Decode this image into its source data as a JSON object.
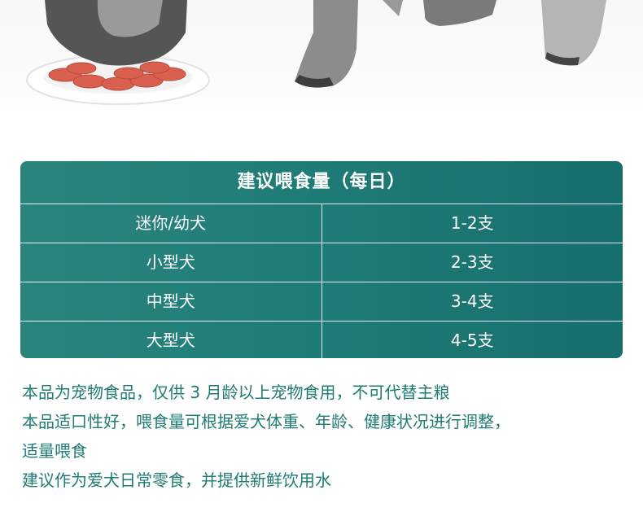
{
  "feeding_table": {
    "title": "建议喂食量（每日）",
    "rows": [
      {
        "size": "迷你/幼犬",
        "amount": "1-2支"
      },
      {
        "size": "小型犬",
        "amount": "2-3支"
      },
      {
        "size": "中型犬",
        "amount": "3-4支"
      },
      {
        "size": "大型犬",
        "amount": "4-5支"
      }
    ]
  },
  "notes": [
    "本品为宠物食品，仅供 3 月龄以上宠物食用，不可代替主粮",
    "本品适口性好，喂食量可根据爱犬体重、年龄、健康状况进行调整，",
    "适量喂食",
    "建议作为爱犬日常零食，并提供新鲜饮用水"
  ],
  "colors": {
    "table_bg": "#1f7b76",
    "note_text": "#1f7b73"
  }
}
